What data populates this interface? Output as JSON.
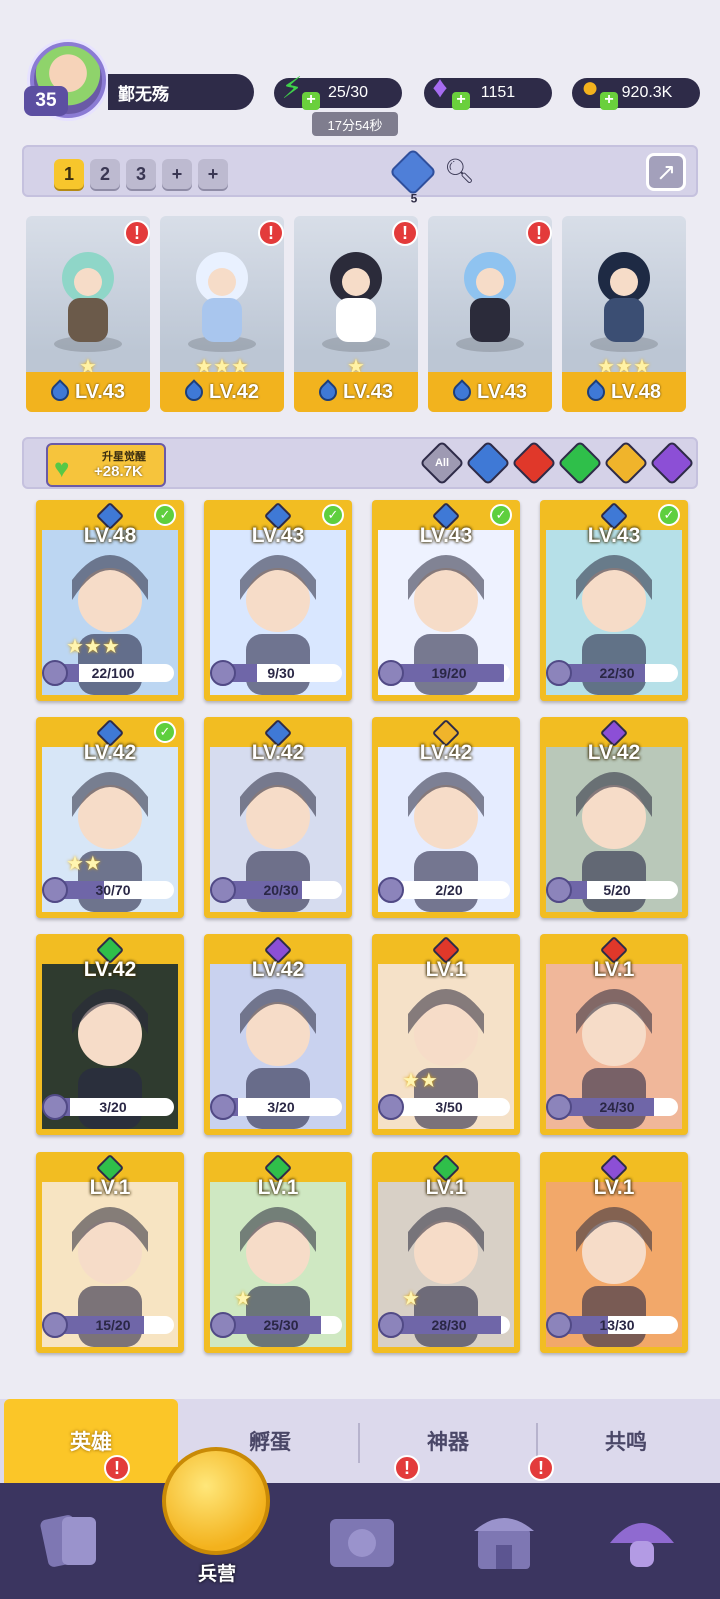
{
  "player": {
    "level": "35",
    "name": "鄞无殇"
  },
  "resources": {
    "stamina": "25/30",
    "stamina_timer": "17分54秒",
    "gems": "1151",
    "coins": "920.3K"
  },
  "team_tabs": [
    "1",
    "2",
    "3",
    "+",
    "+"
  ],
  "element_count": "5",
  "lineup": [
    {
      "level": "LV.43",
      "stars": "★",
      "alert": "!"
    },
    {
      "level": "LV.42",
      "stars": "★★★",
      "alert": "!"
    },
    {
      "level": "LV.43",
      "stars": "★",
      "alert": "!"
    },
    {
      "level": "LV.43",
      "stars": "",
      "alert": "!"
    },
    {
      "level": "LV.48",
      "stars": "★★★",
      "alert": ""
    }
  ],
  "awaken": {
    "label": "升星觉醒",
    "value": "+28.7K"
  },
  "filters": [
    "All",
    "water",
    "fire",
    "wind",
    "light",
    "dark"
  ],
  "colors": {
    "water": "#3f79d6",
    "fire": "#e0382a",
    "wind": "#2fbf4a",
    "light": "#f0b42b",
    "dark": "#8c4fd6",
    "all": "#9e9ab3"
  },
  "heroes": [
    {
      "level": "LV.48",
      "shards": "22/100",
      "progress": 0.22,
      "element": "water",
      "stars": "★★★",
      "check": true
    },
    {
      "level": "LV.43",
      "shards": "9/30",
      "progress": 0.3,
      "element": "water",
      "stars": "",
      "check": true
    },
    {
      "level": "LV.43",
      "shards": "19/20",
      "progress": 0.95,
      "element": "water",
      "stars": "",
      "check": true
    },
    {
      "level": "LV.43",
      "shards": "22/30",
      "progress": 0.73,
      "element": "water",
      "stars": "",
      "check": true
    },
    {
      "level": "LV.42",
      "shards": "30/70",
      "progress": 0.43,
      "element": "water",
      "stars": "★★",
      "check": true
    },
    {
      "level": "LV.42",
      "shards": "20/30",
      "progress": 0.67,
      "element": "water",
      "stars": "",
      "check": false
    },
    {
      "level": "LV.42",
      "shards": "2/20",
      "progress": 0.1,
      "element": "light",
      "stars": "",
      "check": false
    },
    {
      "level": "LV.42",
      "shards": "5/20",
      "progress": 0.25,
      "element": "dark",
      "stars": "",
      "check": false
    },
    {
      "level": "LV.42",
      "shards": "3/20",
      "progress": 0.15,
      "element": "wind",
      "stars": "",
      "check": false
    },
    {
      "level": "LV.42",
      "shards": "3/20",
      "progress": 0.15,
      "element": "dark",
      "stars": "",
      "check": false
    },
    {
      "level": "LV.1",
      "shards": "3/50",
      "progress": 0.06,
      "element": "fire",
      "stars": "★★",
      "check": false
    },
    {
      "level": "LV.1",
      "shards": "24/30",
      "progress": 0.8,
      "element": "fire",
      "stars": "",
      "check": false
    },
    {
      "level": "LV.1",
      "shards": "15/20",
      "progress": 0.75,
      "element": "wind",
      "stars": "",
      "check": false
    },
    {
      "level": "LV.1",
      "shards": "25/30",
      "progress": 0.83,
      "element": "wind",
      "stars": "★",
      "check": false
    },
    {
      "level": "LV.1",
      "shards": "28/30",
      "progress": 0.93,
      "element": "wind",
      "stars": "★",
      "check": false
    },
    {
      "level": "LV.1",
      "shards": "13/30",
      "progress": 0.43,
      "element": "dark",
      "stars": "",
      "check": false
    }
  ],
  "tabs": [
    "英雄",
    "孵蛋",
    "神器",
    "共鸣"
  ],
  "nav": {
    "center_label": "兵营"
  }
}
